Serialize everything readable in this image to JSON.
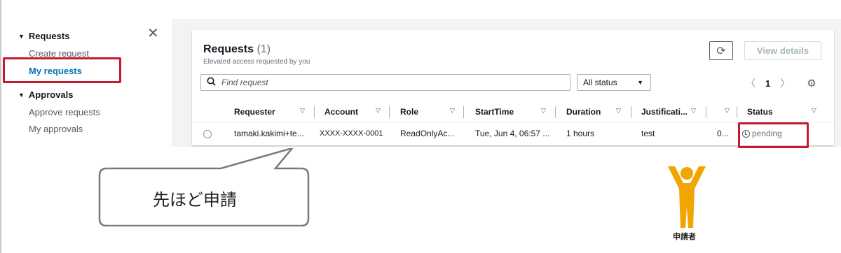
{
  "sidebar": {
    "requests_header": "Requests",
    "create_request": "Create request",
    "my_requests": "My requests",
    "approvals_header": "Approvals",
    "approve_requests": "Approve requests",
    "my_approvals": "My approvals"
  },
  "panel": {
    "title": "Requests",
    "count": "(1)",
    "subtitle": "Elevated access requested by you",
    "refresh_icon": "refresh-icon",
    "view_details": "View details",
    "search_placeholder": "Find request",
    "status_filter": "All status",
    "page_number": "1"
  },
  "table": {
    "columns": [
      "Requester",
      "Account",
      "Role",
      "StartTime",
      "Duration",
      "Justificati...",
      "Status"
    ],
    "rows": [
      {
        "requester": "tamaki.kakimi+te...",
        "account": "XXXX-XXXX-0001",
        "role": "ReadOnlyAc...",
        "start_time": "Tue, Jun 4, 06:57 ...",
        "duration": "1 hours",
        "justification": "test",
        "extra": "0...",
        "status": "pending"
      }
    ]
  },
  "annotation": {
    "callout_text": "先ほど申請",
    "person_label": "申請者"
  },
  "colors": {
    "highlight": "#c7182d",
    "active_link": "#0073bb",
    "figure": "#f0a500"
  }
}
